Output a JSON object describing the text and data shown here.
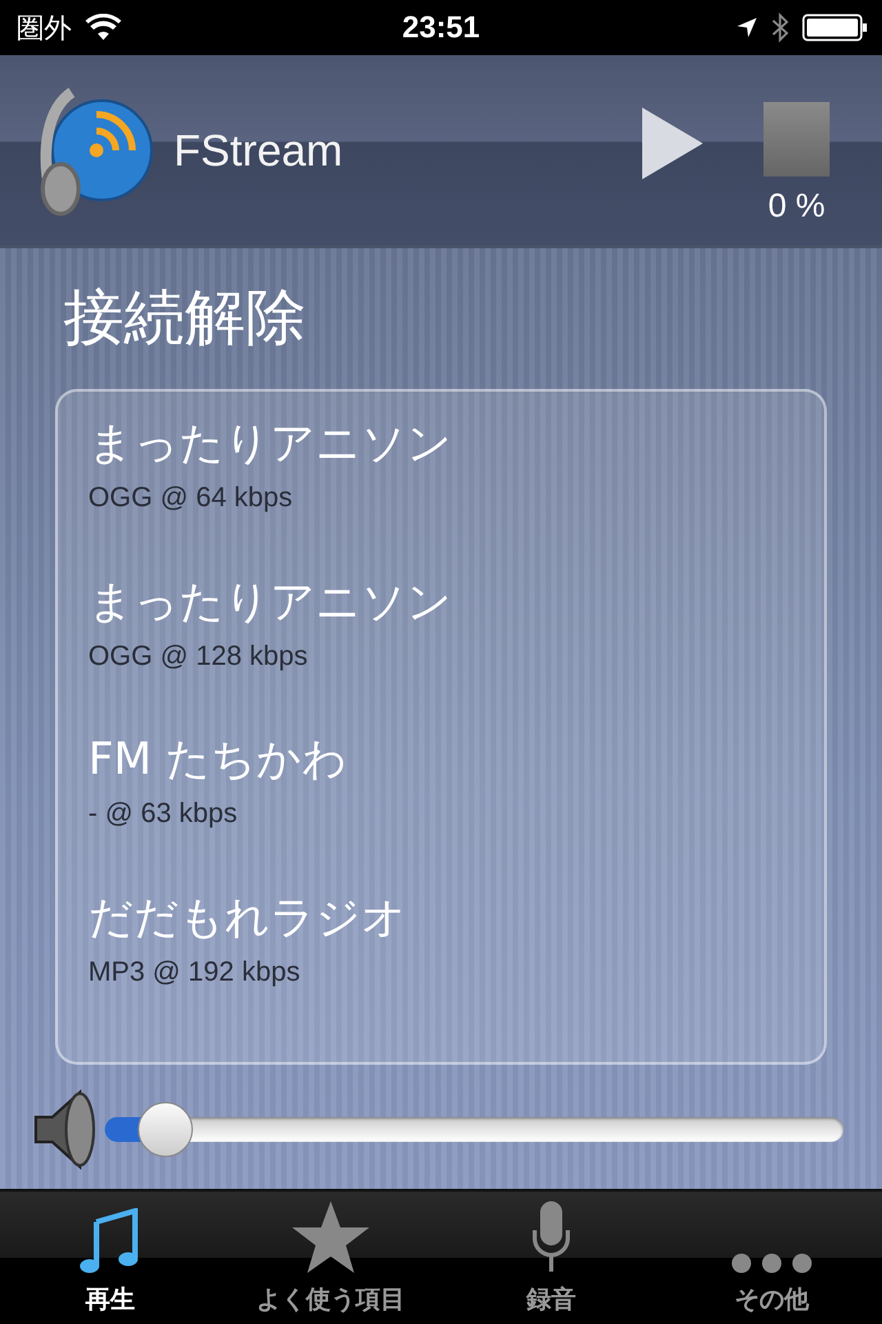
{
  "status_bar": {
    "carrier": "圏外",
    "time": "23:51"
  },
  "header": {
    "title": "FStream",
    "progress": "0 %"
  },
  "heading": "接続解除",
  "stations": [
    {
      "name": "まったりアニソン",
      "info": "OGG @ 64 kbps"
    },
    {
      "name": "まったりアニソン",
      "info": "OGG @ 128 kbps"
    },
    {
      "name": "FM たちかわ",
      "info": "- @ 63 kbps"
    },
    {
      "name": "だだもれラジオ",
      "info": "MP3 @ 192 kbps"
    }
  ],
  "volume": {
    "level": 0.06
  },
  "tabs": [
    {
      "label": "再生",
      "kind": "music",
      "selected": true
    },
    {
      "label": "よく使う項目",
      "kind": "star",
      "selected": false
    },
    {
      "label": "録音",
      "kind": "mic",
      "selected": false
    },
    {
      "label": "その他",
      "kind": "more",
      "selected": false
    }
  ]
}
